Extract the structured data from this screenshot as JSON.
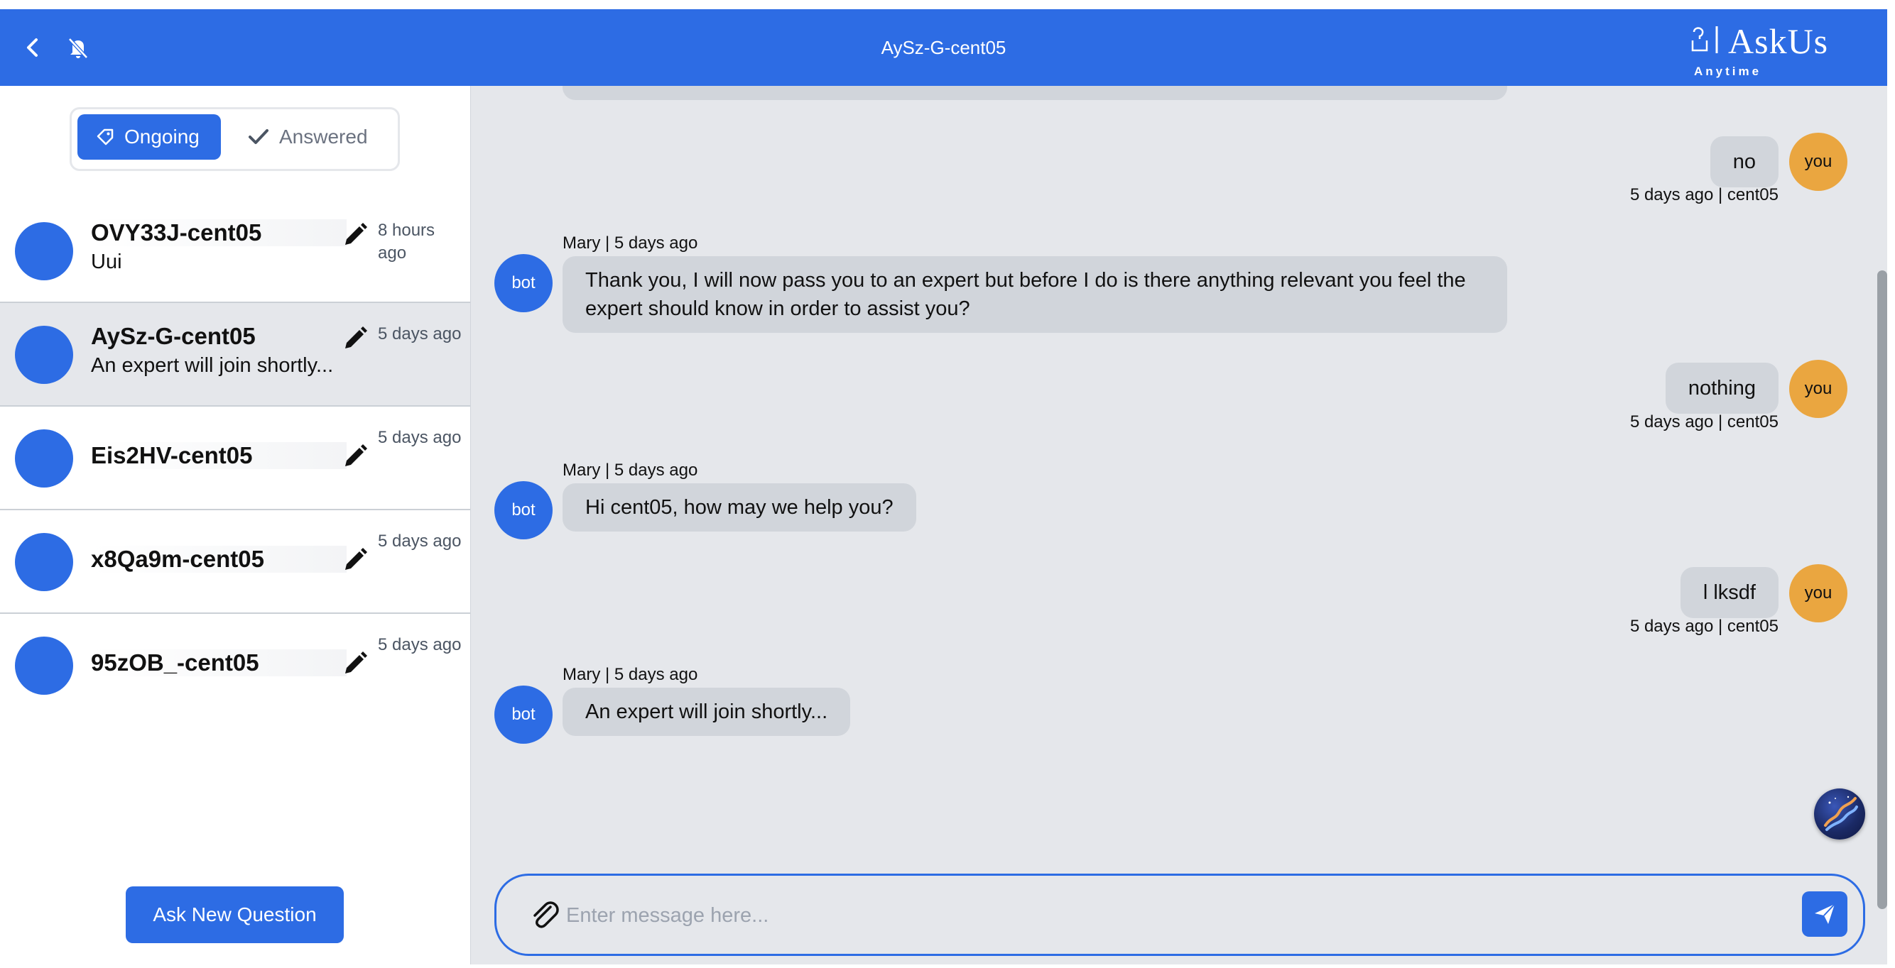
{
  "header": {
    "title": "AySz-G-cent05",
    "back_icon": "chevron-left-icon",
    "mute_icon": "bell-off-icon",
    "logo_brand": "AskUs",
    "logo_sub": "Anytime"
  },
  "tabs": {
    "ongoing": "Ongoing",
    "answered": "Answered"
  },
  "conversations": [
    {
      "name": "OVY33J-cent05",
      "preview": "Uui",
      "time": "8 hours ago"
    },
    {
      "name": "AySz-G-cent05",
      "preview": "An expert will join shortly...",
      "time": "5 days ago"
    },
    {
      "name": "Eis2HV-cent05",
      "preview": "",
      "time": "5 days ago"
    },
    {
      "name": "x8Qa9m-cent05",
      "preview": "",
      "time": "5 days ago"
    },
    {
      "name": "95zOB_-cent05",
      "preview": "",
      "time": "5 days ago"
    }
  ],
  "ask_button": "Ask New Question",
  "messages": [
    {
      "from": "you",
      "text": "no",
      "avatar": "you",
      "meta": "5 days ago | cent05"
    },
    {
      "from": "bot",
      "meta": "Mary | 5 days ago",
      "avatar": "bot",
      "text": "Thank you, I will now pass you to an expert but before I do is there anything relevant you feel the expert should know in order to assist you?"
    },
    {
      "from": "you",
      "text": "nothing",
      "avatar": "you",
      "meta": "5 days ago | cent05"
    },
    {
      "from": "bot",
      "meta": "Mary | 5 days ago",
      "avatar": "bot",
      "text": "Hi cent05, how may we help you?"
    },
    {
      "from": "you",
      "text": "l lksdf",
      "avatar": "you",
      "meta": "5 days ago | cent05"
    },
    {
      "from": "bot",
      "meta": "Mary | 5 days ago",
      "avatar": "bot",
      "text": "An expert will join shortly..."
    }
  ],
  "composer": {
    "placeholder": "Enter message here..."
  },
  "colors": {
    "primary": "#2d6ce4",
    "you_avatar": "#eaa640",
    "bubble": "#d1d5db",
    "chat_bg": "#e5e7eb"
  }
}
